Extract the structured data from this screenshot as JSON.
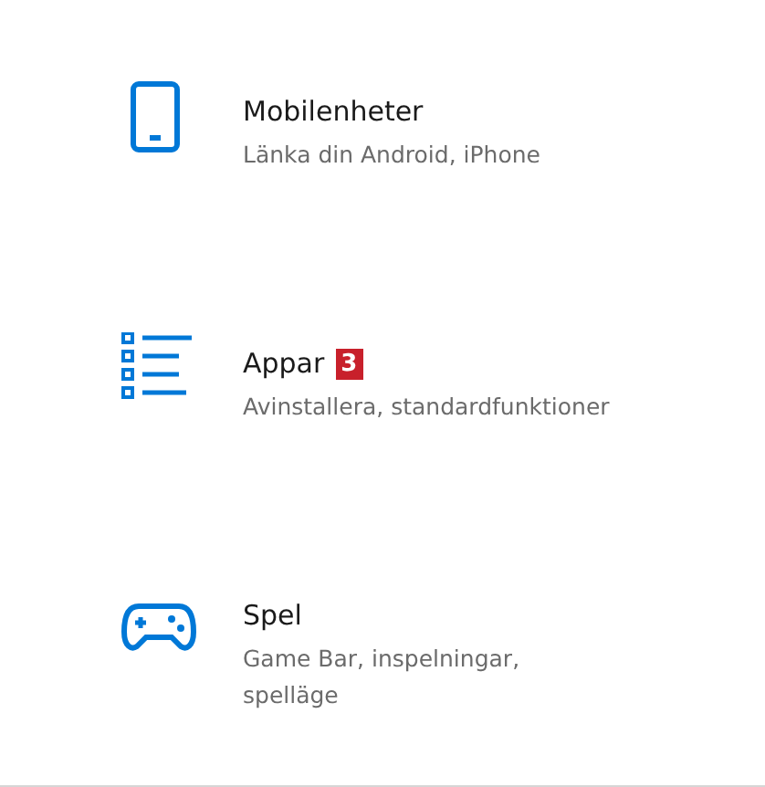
{
  "items": [
    {
      "title": "Mobilenheter",
      "description": "Länka din Android, iPhone"
    },
    {
      "title": "Appar",
      "badge": "3",
      "description": "Avinstallera, standardfunktioner"
    },
    {
      "title": "Spel",
      "description": "Game Bar, inspelningar,\nspelläge"
    }
  ]
}
